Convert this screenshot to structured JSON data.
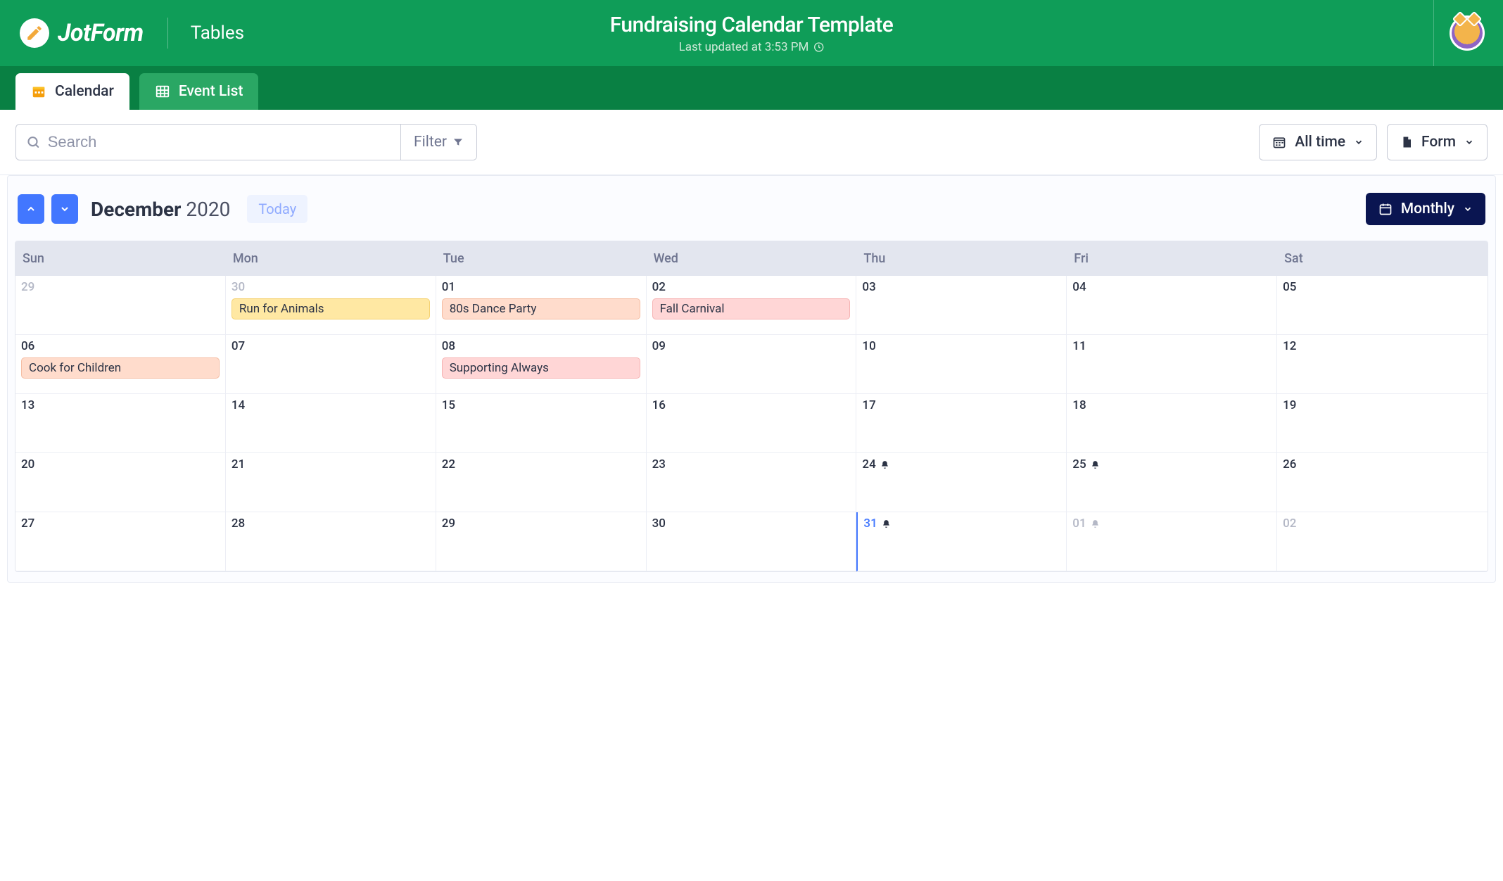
{
  "brand": {
    "name": "JotForm",
    "section": "Tables"
  },
  "header": {
    "title": "Fundraising Calendar Template",
    "subtitle": "Last updated at 3:53 PM"
  },
  "tabs": [
    {
      "id": "calendar",
      "label": "Calendar",
      "active": true
    },
    {
      "id": "eventlist",
      "label": "Event List",
      "active": false
    }
  ],
  "toolbar": {
    "search_placeholder": "Search",
    "filter_label": "Filter",
    "time_range_label": "All time",
    "form_label": "Form"
  },
  "calendar": {
    "month": "December",
    "year": "2020",
    "today_label": "Today",
    "view_label": "Monthly",
    "weekdays": [
      "Sun",
      "Mon",
      "Tue",
      "Wed",
      "Thu",
      "Fri",
      "Sat"
    ],
    "cells": [
      {
        "num": "29",
        "muted": true
      },
      {
        "num": "30",
        "muted": true,
        "events": [
          {
            "label": "Run for Animals",
            "color": "yellow"
          }
        ]
      },
      {
        "num": "01",
        "events": [
          {
            "label": "80s Dance Party",
            "color": "peach"
          }
        ]
      },
      {
        "num": "02",
        "events": [
          {
            "label": "Fall Carnival",
            "color": "pink"
          }
        ]
      },
      {
        "num": "03"
      },
      {
        "num": "04"
      },
      {
        "num": "05"
      },
      {
        "num": "06",
        "events": [
          {
            "label": "Cook for Children",
            "color": "peach"
          }
        ]
      },
      {
        "num": "07"
      },
      {
        "num": "08",
        "events": [
          {
            "label": "Supporting Always",
            "color": "pink"
          }
        ]
      },
      {
        "num": "09"
      },
      {
        "num": "10"
      },
      {
        "num": "11"
      },
      {
        "num": "12"
      },
      {
        "num": "13"
      },
      {
        "num": "14"
      },
      {
        "num": "15"
      },
      {
        "num": "16"
      },
      {
        "num": "17"
      },
      {
        "num": "18"
      },
      {
        "num": "19"
      },
      {
        "num": "20"
      },
      {
        "num": "21"
      },
      {
        "num": "22"
      },
      {
        "num": "23"
      },
      {
        "num": "24",
        "bell": true
      },
      {
        "num": "25",
        "bell": true
      },
      {
        "num": "26"
      },
      {
        "num": "27"
      },
      {
        "num": "28"
      },
      {
        "num": "29"
      },
      {
        "num": "30"
      },
      {
        "num": "31",
        "today": true,
        "bell": true
      },
      {
        "num": "01",
        "muted": true,
        "bell": true
      },
      {
        "num": "02",
        "muted": true
      }
    ]
  }
}
